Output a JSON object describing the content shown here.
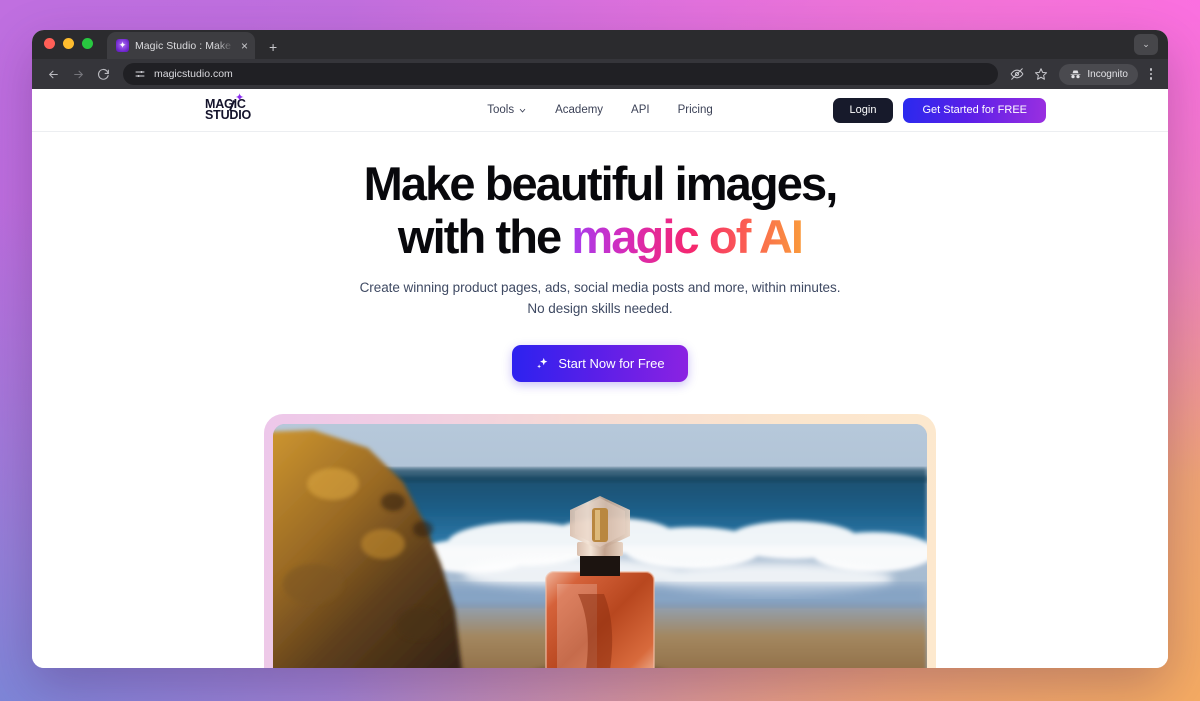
{
  "browser": {
    "tab": {
      "title": "Magic Studio : Make beautiful",
      "favicon": "sparkle-favicon",
      "close_label": "×"
    },
    "new_tab_label": "+",
    "window_chevron": "⌄",
    "address": {
      "url": "magicstudio.com",
      "site_settings_icon": "tune-icon"
    },
    "actions": {
      "back": "back-arrow",
      "forward": "forward-arrow",
      "reload": "reload-icon",
      "hide_tracking": "eye-off-icon",
      "bookmark": "star-icon",
      "incognito_label": "Incognito",
      "incognito_icon": "incognito-hat-icon",
      "menu": "kebab-menu-icon"
    }
  },
  "site": {
    "logo": {
      "line1": "MAGIC",
      "line2": "STUDIO",
      "sparkle": "✦"
    },
    "nav": [
      {
        "label": "Tools",
        "has_chevron": true
      },
      {
        "label": "Academy",
        "has_chevron": false
      },
      {
        "label": "API",
        "has_chevron": false
      },
      {
        "label": "Pricing",
        "has_chevron": false
      }
    ],
    "header_buttons": {
      "login": "Login",
      "get_started": "Get Started for FREE"
    },
    "hero": {
      "headline_line1": "Make beautiful images,",
      "headline_line2_plain": "with the ",
      "headline_line2_gradient": "magic of AI",
      "subtitle_line1": "Create winning product pages, ads, social media posts and more, within minutes.",
      "subtitle_line2": "No design skills needed.",
      "cta_label": "Start Now for Free",
      "cta_icon": "sparkles-icon",
      "image_alt": "Perfume bottle on a beach with ocean waves and a rocky cliff"
    }
  },
  "colors": {
    "accent_blue": "#2c22ef",
    "accent_purple": "#8b22e2",
    "logo_sparkle": "#8b2ff0",
    "login_bg": "#171a2b",
    "text_dark": "#08080c",
    "text_muted": "#3f4a63"
  }
}
